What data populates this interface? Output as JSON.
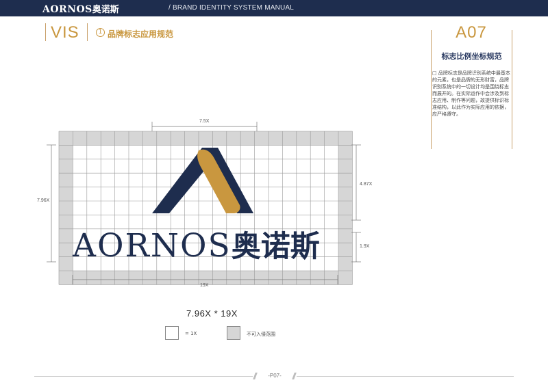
{
  "header": {
    "brand_latin": "AORNOS",
    "brand_cn": "奥诺斯",
    "manual_title": "/ BRAND IDENTITY SYSTEM MANUAL"
  },
  "section": {
    "code": "VIS",
    "number": "1",
    "title": "品牌标志应用规范"
  },
  "panel": {
    "code": "A07",
    "heading": "标志比例坐标规范",
    "description": "□ 品牌标志是品牌识别系统中最基本的元素，也是品牌的无形财富，品牌识别系统中的一切设计均是围绕标志而展开的。在实际运作中会涉及到标志应用、制作等问题，故提供标识标准结构，以此作为实际应用的依据，应严格遵守。"
  },
  "diagram": {
    "logo_latin": "AORNOS",
    "logo_cn": "奥诺斯",
    "dim_top": "7.5X",
    "dim_left": "7.96X",
    "dim_right_upper": "4.87X",
    "dim_right_lower": "1.9X",
    "dim_bottom": "19X",
    "ratio": "7.96X * 19X",
    "colors": {
      "navy": "#1e2d4e",
      "gold": "#c9973f",
      "grid_line": "#9a9a9a",
      "margin_fill": "#d6d6d6"
    }
  },
  "legend": {
    "unit_label": "= 1X",
    "margin_label": "不可入侵范围"
  },
  "footer": {
    "page": "-P07-"
  }
}
